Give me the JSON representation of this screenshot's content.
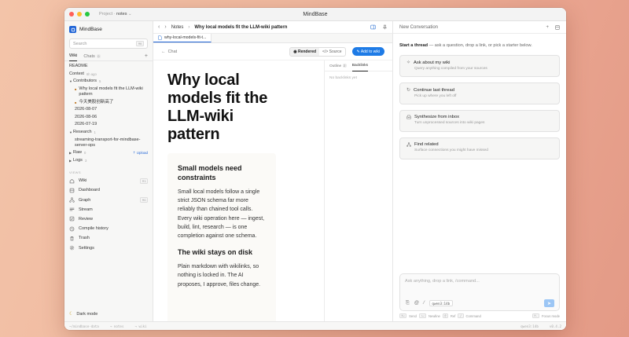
{
  "window": {
    "title": "MindBase",
    "project_label": "Project",
    "project_sep": "·",
    "project_name": "notes"
  },
  "sidebar": {
    "brand": "MindBase",
    "search_placeholder": "Search",
    "search_kbd": "⌘K",
    "tabs": [
      {
        "label": "Wiki"
      },
      {
        "label": "Chats",
        "count": "0"
      }
    ],
    "readme": "README",
    "context": {
      "label": "Context",
      "meta": "6h ago"
    },
    "contributors": {
      "label": "Contributors",
      "count": "5"
    },
    "contributor_items": [
      "Why local models fit the LLM-wiki pattern",
      "今天美股创新高了",
      "2026-08-07",
      "2026-08-06",
      "2026-07-19"
    ],
    "research": {
      "label": "Research",
      "count": "1"
    },
    "research_item": "streaming-transport-for-mindbase-server-ops",
    "raw": {
      "label": "Raw",
      "count": "0",
      "upload": "Upload"
    },
    "logs": {
      "label": "Logs",
      "count": "3"
    },
    "views_label": "VIEWS",
    "views": [
      {
        "label": "Wiki",
        "kbd": "⌘1"
      },
      {
        "label": "Dashboard"
      },
      {
        "label": "Graph",
        "kbd": "⌘G"
      },
      {
        "label": "Stream"
      },
      {
        "label": "Review"
      },
      {
        "label": "Compile history"
      },
      {
        "label": "Trash"
      },
      {
        "label": "Settings"
      }
    ],
    "dark_mode": "Dark mode"
  },
  "center": {
    "breadcrumb": {
      "parent": "Notes",
      "current": "Why local models fit the LLM-wiki pattern"
    },
    "tab_label": "why-local-models-fit-t...",
    "back": "Chat",
    "view_rendered": "Rendered",
    "view_source": "Source",
    "add_to_wiki": "Add to wiki",
    "doc": {
      "title": "Why local models fit the LLM-wiki pattern",
      "h1": "Small models need constraints",
      "p1": "Small local models follow a single strict JSON schema far more reliably than chained tool calls. Every wiki operation here — ingest, build, lint, research — is one completion against one schema.",
      "h2": "The wiki stays on disk",
      "p2": "Plain markdown with wikilinks, so nothing is locked in. The AI proposes, I approve, files change."
    },
    "side": {
      "outline": "Outline",
      "outline_count": "2",
      "backlinks": "Backlinks",
      "empty": "No backlinks yet"
    }
  },
  "right": {
    "header": "New Conversation",
    "intro_bold": "Start a thread",
    "intro_rest": " — ask a question, drop a link, or pick a starter below.",
    "starters": [
      {
        "title": "Ask about my wiki",
        "sub": "Query anything compiled from your sources",
        "icon": "sparkle-icon"
      },
      {
        "title": "Continue last thread",
        "sub": "Pick up where you left off",
        "icon": "refresh-icon"
      },
      {
        "title": "Synthesize from inbox",
        "sub": "Turn unprocessed sources into wiki pages",
        "icon": "inbox-icon"
      },
      {
        "title": "Find related",
        "sub": "Surface connections you might have missed",
        "icon": "network-icon"
      }
    ],
    "composer_placeholder": "Ask anything, drop a link, /command...",
    "model": "qwen3:14b",
    "hints": [
      {
        "kbd": "⌘↵",
        "label": "Send"
      },
      {
        "kbd": "⇧↵",
        "label": "Newline"
      },
      {
        "kbd": "@",
        "label": "Ref"
      },
      {
        "kbd": "/",
        "label": "Command"
      }
    ],
    "focus_kbd": "⌘.",
    "focus_label": "Focus mode"
  },
  "statusbar": {
    "path": "~/mindbase-data",
    "project": "→ notes",
    "view": "→ wiki",
    "model": "qwen3:14b",
    "version": "v0.4.2"
  },
  "colors": {
    "accent": "#1e7be6",
    "brand": "#1e63d6"
  }
}
